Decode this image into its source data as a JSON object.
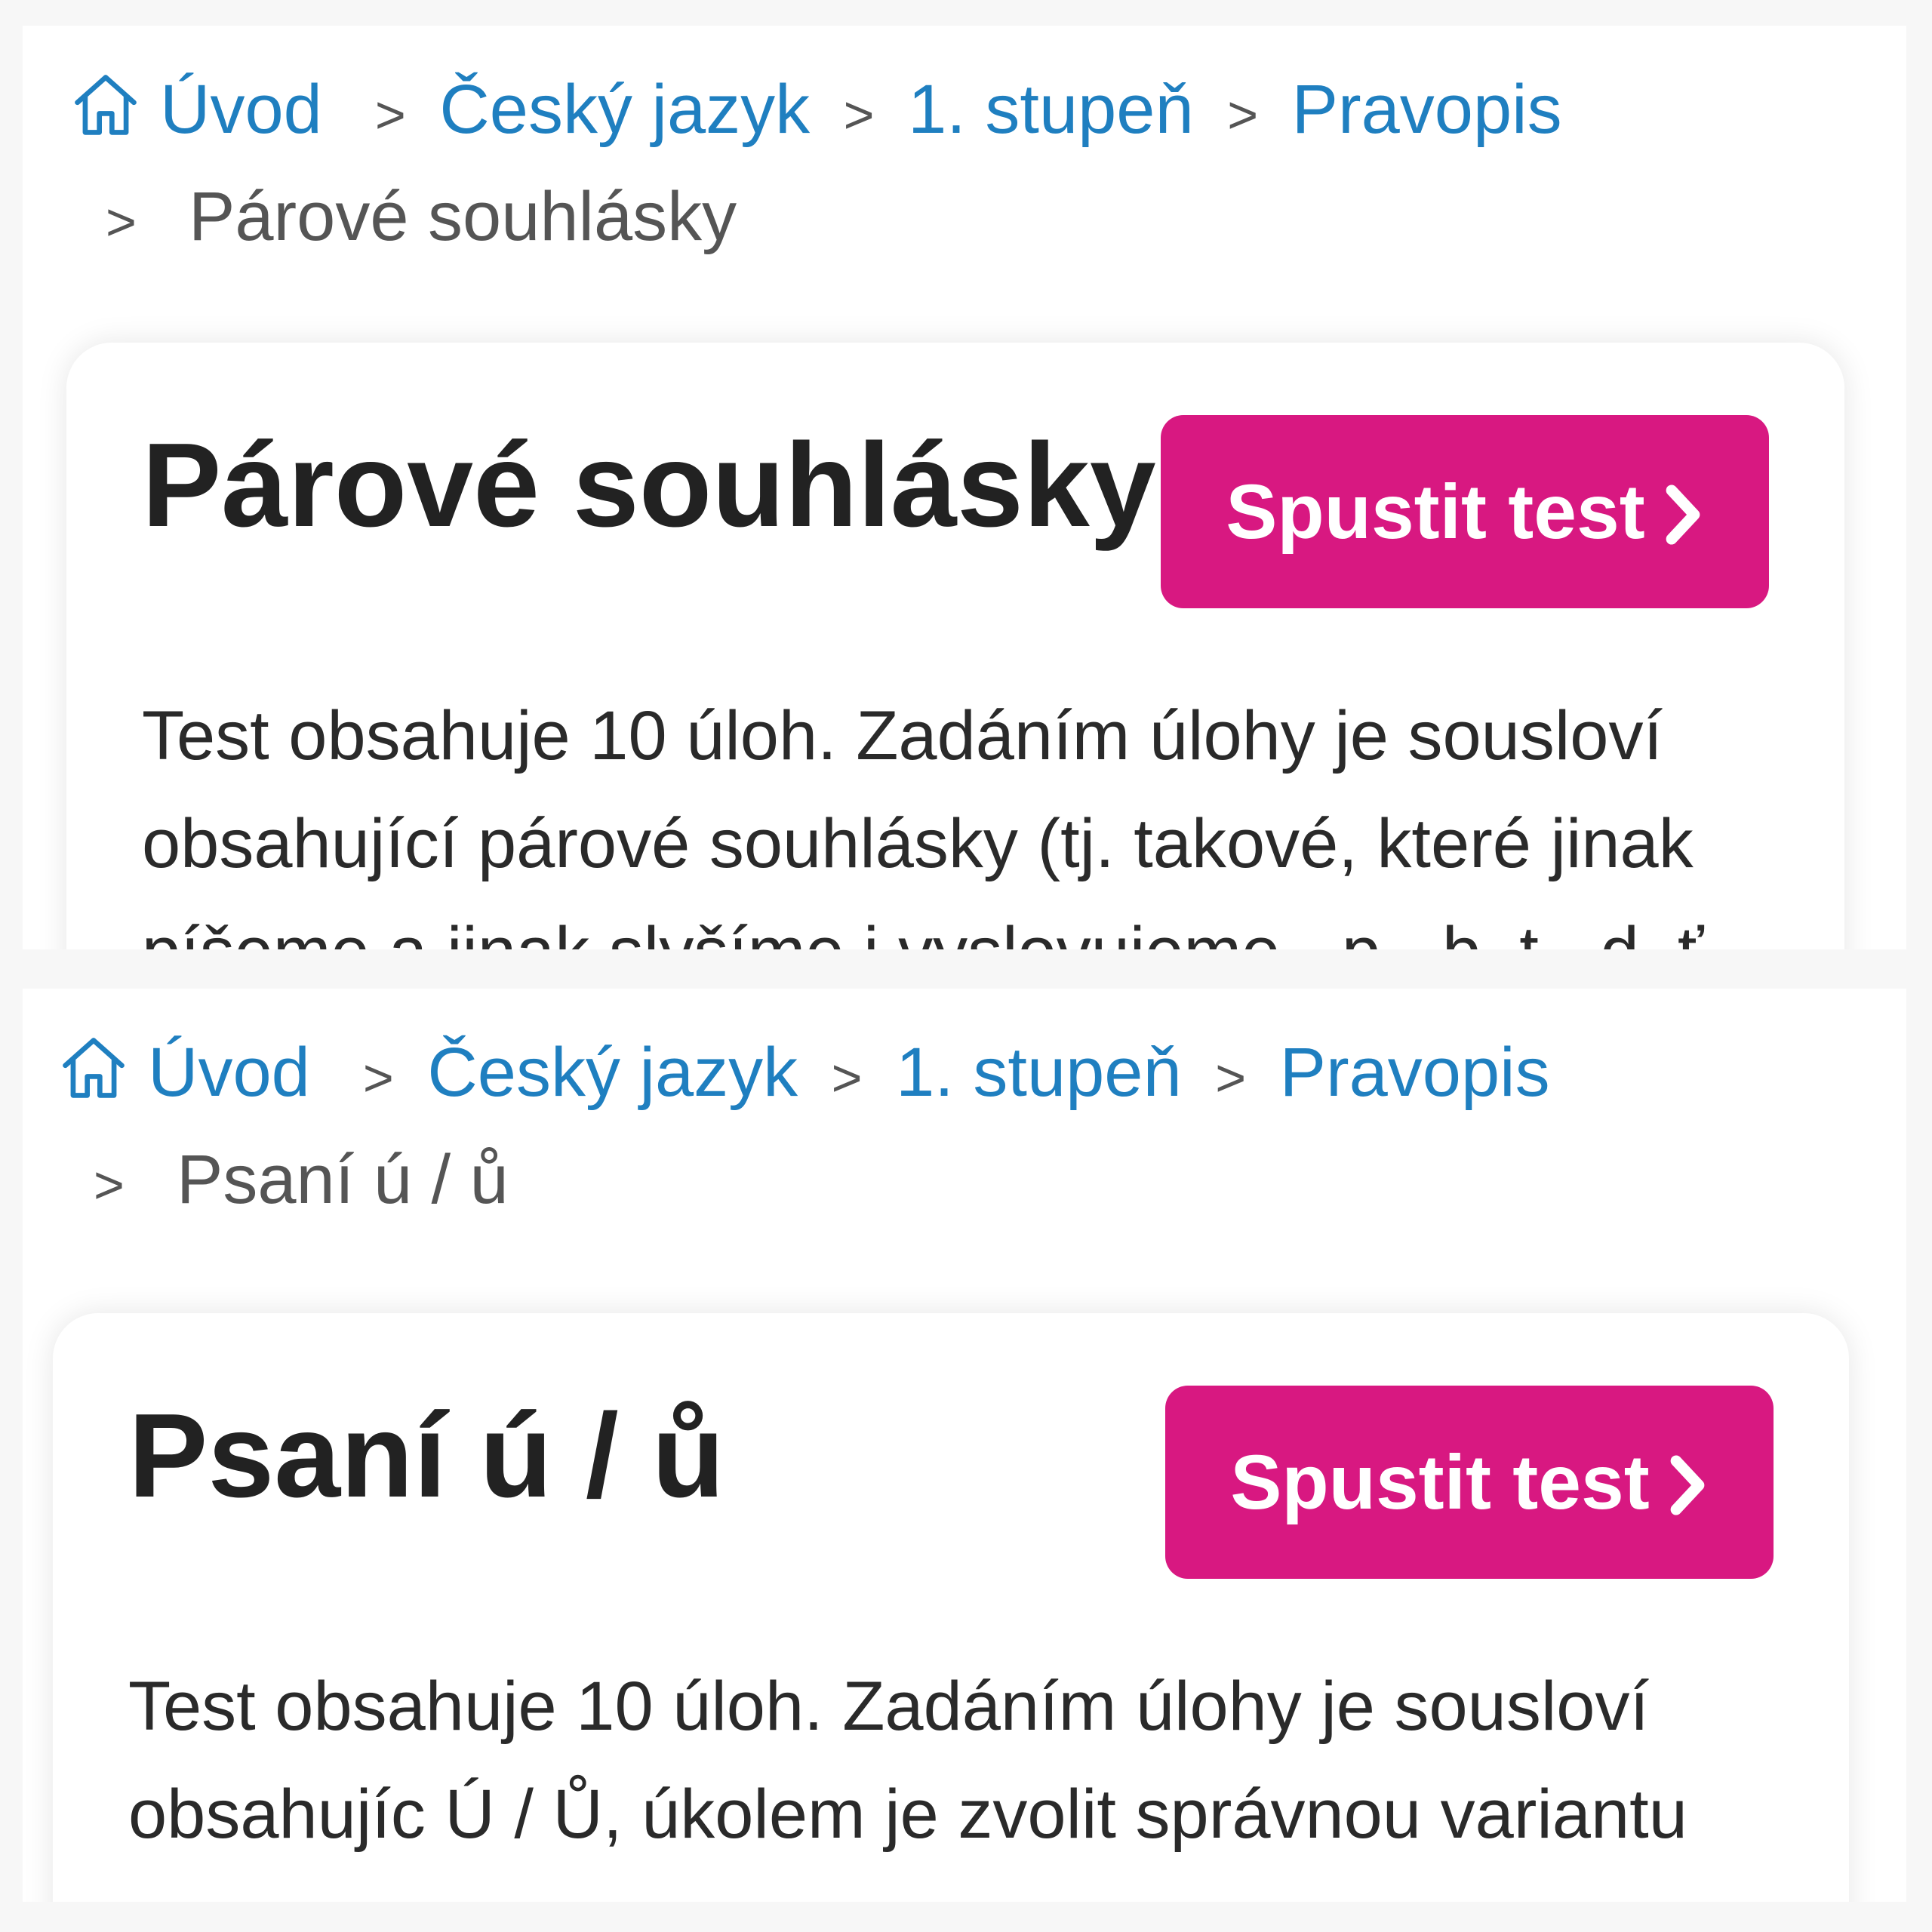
{
  "screens": [
    {
      "breadcrumb": {
        "home_icon": "home-icon",
        "home": "Úvod",
        "items": [
          "Český jazyk",
          "1. stupeň",
          "Pravopis"
        ],
        "separator": ">",
        "current": "Párové souhlásky"
      },
      "card": {
        "title": "Párové souhlásky",
        "button_label": "Spustit test",
        "button_icon": "chevron-right-icon",
        "description": "Test obsahuje 10 úloh. Zadáním úlohy je sousloví obsahující párové souhlásky (tj. takové, které jinak píšeme a jinak slyšíme i vyslovujeme - p - b, t - d, ť"
      }
    },
    {
      "breadcrumb": {
        "home_icon": "home-icon",
        "home": "Úvod",
        "items": [
          "Český jazyk",
          "1. stupeň",
          "Pravopis"
        ],
        "separator": ">",
        "current": "Psaní ú / ů"
      },
      "card": {
        "title": "Psaní ú / ů",
        "button_label": "Spustit test",
        "button_icon": "chevron-right-icon",
        "description": "Test obsahuje 10 úloh. Zadáním úlohy je sousloví obsahujíc Ú / Ů, úkolem je zvolit správnou variantu"
      }
    }
  ],
  "colors": {
    "link": "#1f7fc0",
    "accent": "#d81881",
    "text": "#222222",
    "muted": "#555555"
  }
}
